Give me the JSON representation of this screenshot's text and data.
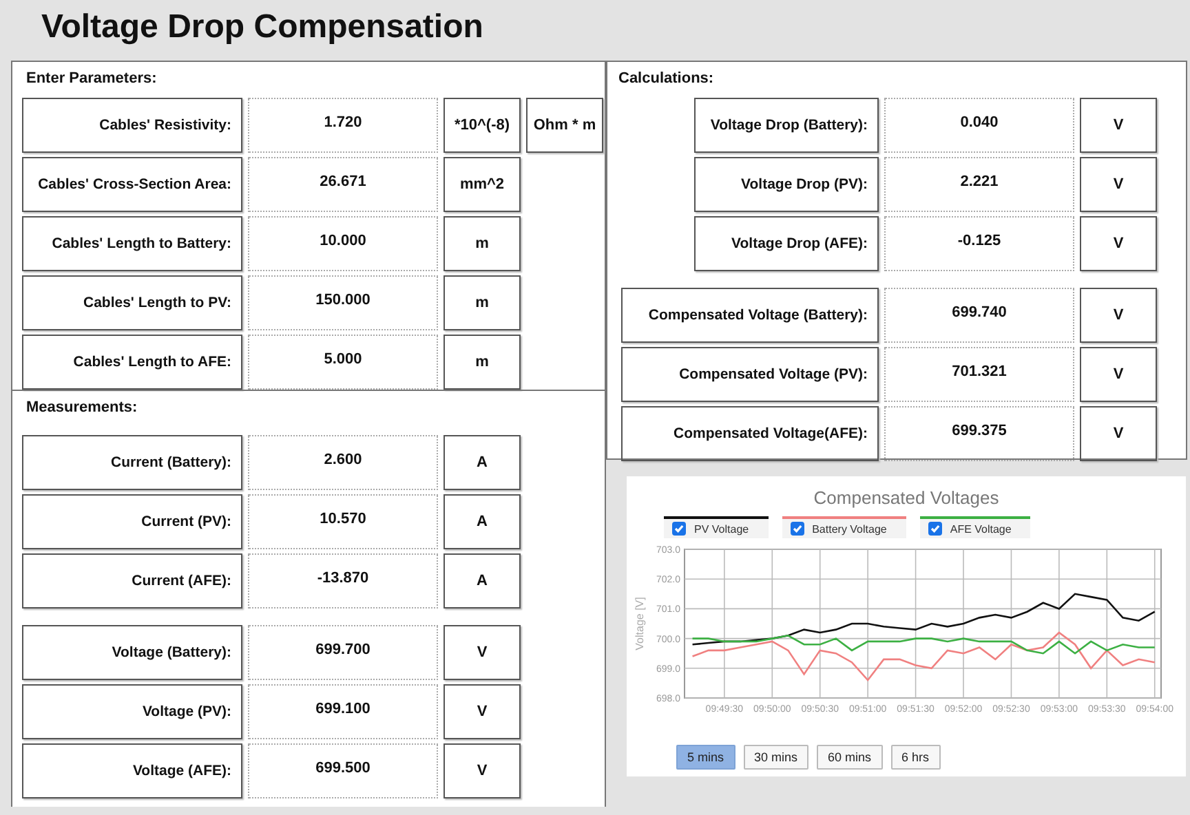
{
  "title": "Voltage Drop Compensation",
  "parameters": {
    "heading": "Enter Parameters:",
    "rows": [
      {
        "label": "Cables' Resistivity:",
        "value": "1.720",
        "units": [
          "*10^(-8)",
          "Ohm * m"
        ]
      },
      {
        "label": "Cables' Cross-Section Area:",
        "value": "26.671",
        "units": [
          "mm^2"
        ]
      },
      {
        "label": "Cables' Length to Battery:",
        "value": "10.000",
        "units": [
          "m"
        ]
      },
      {
        "label": "Cables' Length to PV:",
        "value": "150.000",
        "units": [
          "m"
        ]
      },
      {
        "label": "Cables' Length to AFE:",
        "value": "5.000",
        "units": [
          "m"
        ]
      }
    ]
  },
  "measurements": {
    "heading": "Measurements:",
    "groups": [
      [
        {
          "label": "Current (Battery):",
          "value": "2.600",
          "units": [
            "A"
          ]
        },
        {
          "label": "Current (PV):",
          "value": "10.570",
          "units": [
            "A"
          ]
        },
        {
          "label": "Current (AFE):",
          "value": "-13.870",
          "units": [
            "A"
          ]
        }
      ],
      [
        {
          "label": "Voltage (Battery):",
          "value": "699.700",
          "units": [
            "V"
          ]
        },
        {
          "label": "Voltage (PV):",
          "value": "699.100",
          "units": [
            "V"
          ]
        },
        {
          "label": "Voltage (AFE):",
          "value": "699.500",
          "units": [
            "V"
          ]
        }
      ]
    ]
  },
  "calculations": {
    "heading": "Calculations:",
    "groups": [
      [
        {
          "label": "Voltage Drop (Battery):",
          "value": "0.040",
          "units": [
            "V"
          ]
        },
        {
          "label": "Voltage Drop (PV):",
          "value": "2.221",
          "units": [
            "V"
          ]
        },
        {
          "label": "Voltage Drop (AFE):",
          "value": "-0.125",
          "units": [
            "V"
          ]
        }
      ],
      [
        {
          "label": "Compensated Voltage (Battery):",
          "value": "699.740",
          "units": [
            "V"
          ]
        },
        {
          "label": "Compensated Voltage (PV):",
          "value": "701.321",
          "units": [
            "V"
          ]
        },
        {
          "label": "Compensated Voltage(AFE):",
          "value": "699.375",
          "units": [
            "V"
          ]
        }
      ]
    ]
  },
  "chart": {
    "legend": [
      {
        "checked": true
      },
      {
        "checked": true
      },
      {
        "checked": true
      }
    ],
    "ranges": [
      {
        "label": "5 mins",
        "selected": true
      },
      {
        "label": "30 mins",
        "selected": false
      },
      {
        "label": "60 mins",
        "selected": false
      },
      {
        "label": "6 hrs",
        "selected": false
      }
    ],
    "chart_data": {
      "type": "line",
      "title": "Compensated Voltages",
      "ylabel": "Voltage [V]",
      "categories": [
        null,
        null,
        "09:49:30",
        null,
        null,
        "09:50:00",
        null,
        null,
        "09:50:30",
        null,
        null,
        "09:51:00",
        null,
        null,
        "09:51:30",
        null,
        null,
        "09:52:00",
        null,
        null,
        "09:52:30",
        null,
        null,
        "09:53:00",
        null,
        null,
        "09:53:30",
        null,
        null,
        "09:54:00"
      ],
      "ylim": [
        698,
        703
      ],
      "grid": true,
      "yticks": [
        {
          "value": 698,
          "label": "698.0"
        },
        {
          "value": 699,
          "label": "699.0"
        },
        {
          "value": 700,
          "label": "700.0"
        },
        {
          "value": 701,
          "label": "701.0"
        },
        {
          "value": 702,
          "label": "702.0"
        },
        {
          "value": 703,
          "label": "703.0"
        }
      ],
      "series": [
        {
          "name": "PV Voltage",
          "color": "#111111",
          "values": [
            699.8,
            699.85,
            699.9,
            699.9,
            699.95,
            700.0,
            700.1,
            700.3,
            700.2,
            700.3,
            700.5,
            700.5,
            700.4,
            700.35,
            700.3,
            700.5,
            700.4,
            700.5,
            700.7,
            700.8,
            700.7,
            700.9,
            701.2,
            701.0,
            701.5,
            701.4,
            701.3,
            700.7,
            700.6,
            700.9
          ]
        },
        {
          "name": "Battery Voltage",
          "color": "#f08080",
          "values": [
            699.4,
            699.6,
            699.6,
            699.7,
            699.8,
            699.9,
            699.6,
            698.8,
            699.6,
            699.5,
            699.2,
            698.6,
            699.3,
            699.3,
            699.1,
            699.0,
            699.6,
            699.5,
            699.7,
            699.3,
            699.8,
            699.6,
            699.7,
            700.2,
            699.8,
            699.0,
            699.6,
            699.1,
            699.3,
            699.2
          ]
        },
        {
          "name": "AFE Voltage",
          "color": "#3cb043",
          "values": [
            700.0,
            700.0,
            699.9,
            699.9,
            699.9,
            700.0,
            700.1,
            699.8,
            699.8,
            700.0,
            699.6,
            699.9,
            699.9,
            699.9,
            700.0,
            700.0,
            699.9,
            700.0,
            699.9,
            699.9,
            699.9,
            699.6,
            699.5,
            699.9,
            699.5,
            699.9,
            699.6,
            699.8,
            699.7,
            699.7
          ]
        }
      ]
    }
  }
}
